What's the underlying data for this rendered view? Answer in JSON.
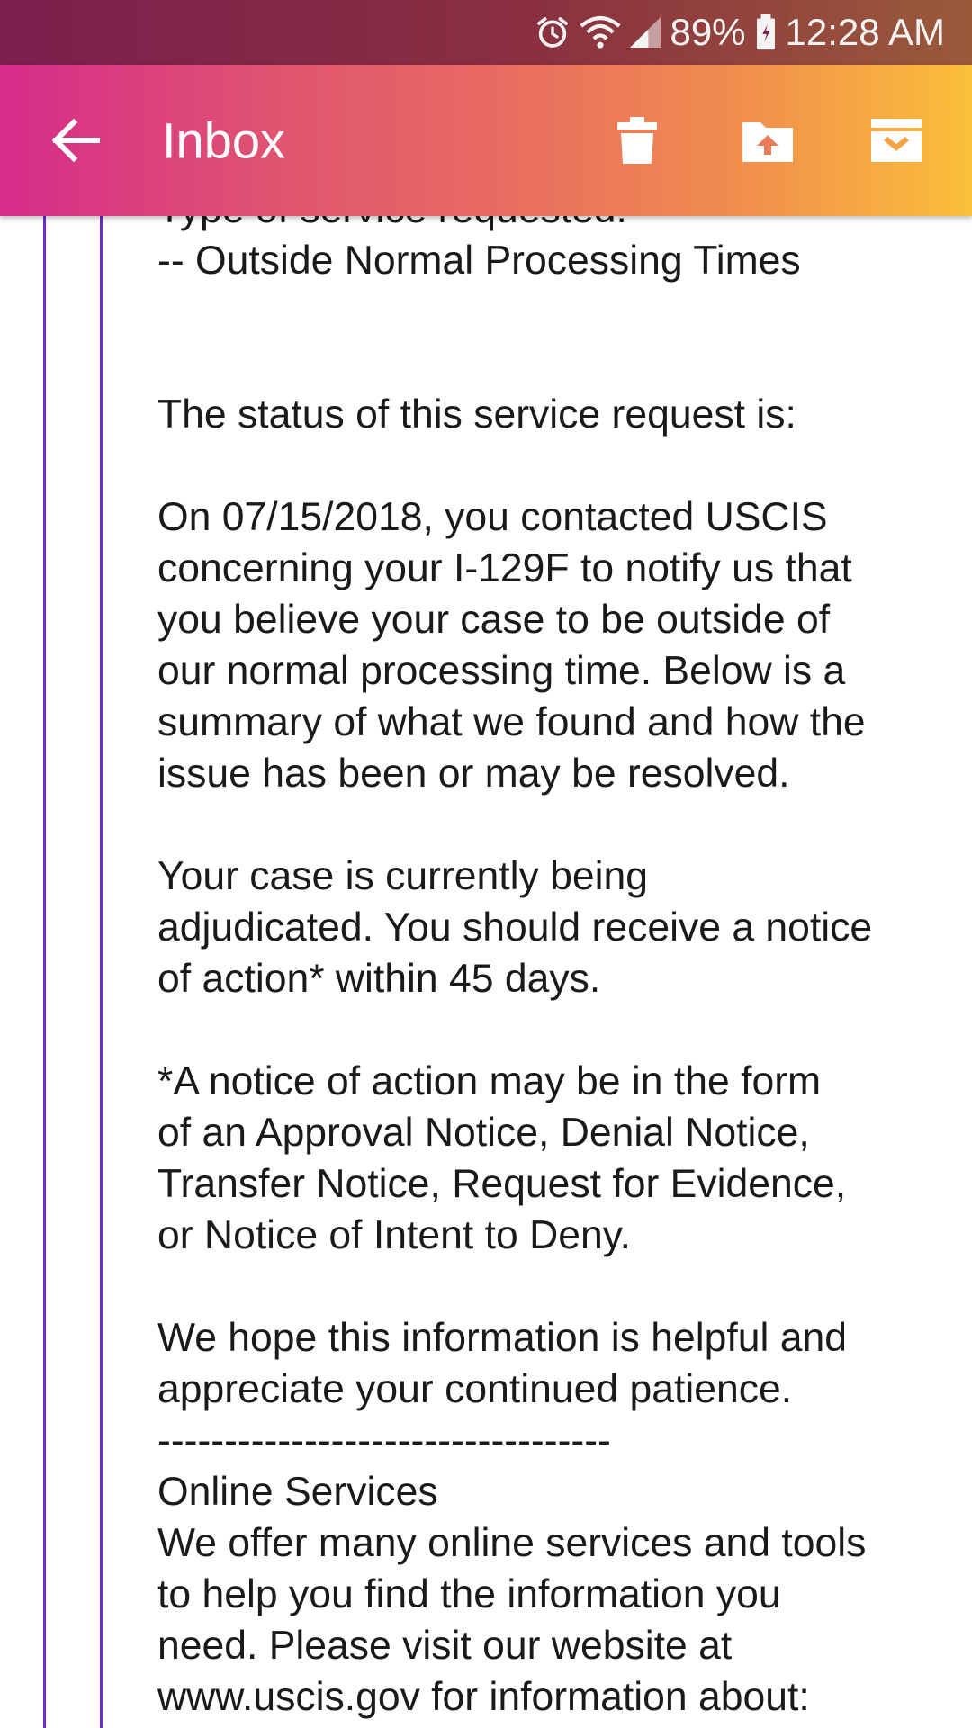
{
  "status_bar": {
    "icons": [
      "alarm-icon",
      "wifi-icon",
      "signal-icon",
      "battery-icon"
    ],
    "battery": "89%",
    "time": "12:28 AM"
  },
  "app_bar": {
    "title": "Inbox",
    "actions": [
      "delete-icon",
      "move-to-folder-icon",
      "archive-icon"
    ],
    "colors": {
      "gradient_start": "#d62c8a",
      "gradient_end": "#fbbf3a"
    }
  },
  "email": {
    "lines": [
      "Type of service requested:",
      "-- Outside Normal Processing Times",
      "",
      "",
      "The status of this service request is:",
      "",
      "On 07/15/2018, you contacted USCIS",
      "concerning your I-129F to notify us that",
      "you believe your case to be outside of",
      "our normal processing time. Below is a",
      "summary of what we found and how the",
      "issue has been or may be resolved.",
      "",
      "Your case is currently being",
      "adjudicated. You should receive a notice",
      "of action* within 45 days.",
      "",
      "*A notice of action may be in the form",
      "of an Approval Notice, Denial Notice,",
      "Transfer Notice, Request for Evidence,",
      "or Notice of Intent to Deny.",
      "",
      "We hope this information is helpful and",
      "appreciate your continued patience.",
      "----------------------------------",
      "Online Services",
      "We offer many online services and tools",
      "to help you find the information you",
      "need. Please visit our website at",
      "www.uscis.gov for information about:"
    ],
    "quote_bar_color": "#6b2fd0"
  }
}
